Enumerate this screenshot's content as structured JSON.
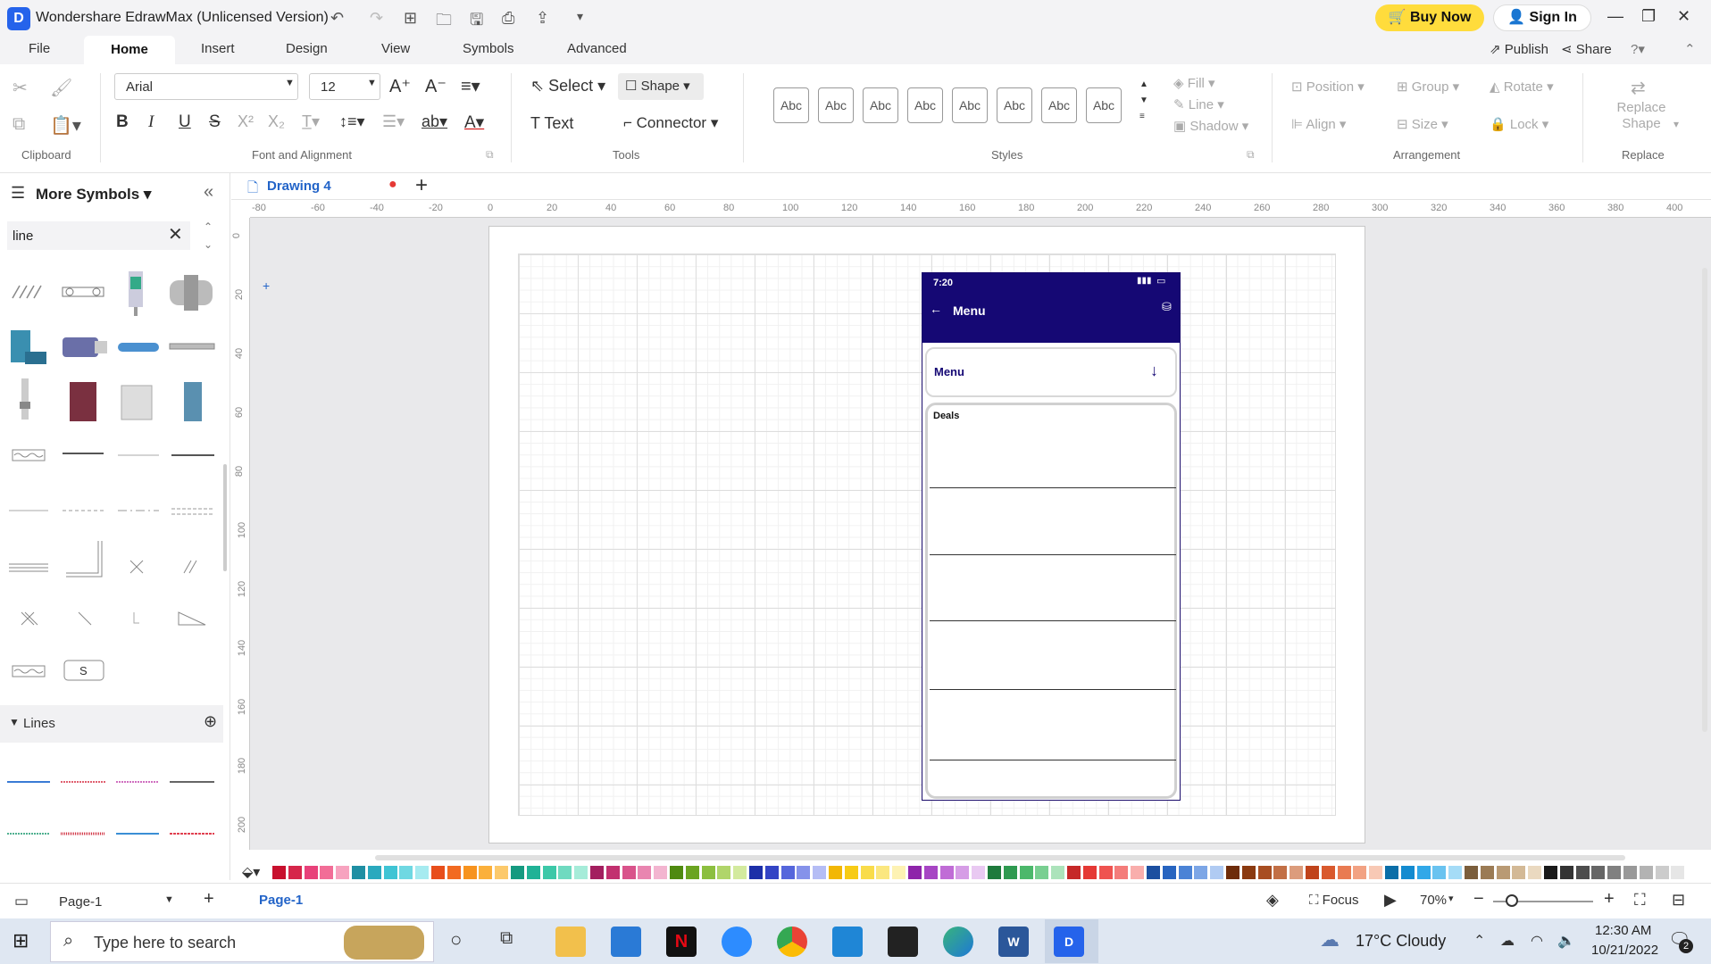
{
  "app": {
    "title": "Wondershare EdrawMax (Unlicensed Version)",
    "buy_now": "Buy Now",
    "sign_in": "Sign In",
    "publish": "Publish",
    "share": "Share"
  },
  "menu": {
    "tabs": [
      "File",
      "Home",
      "Insert",
      "Design",
      "View",
      "Symbols",
      "Advanced"
    ]
  },
  "ribbon": {
    "font": "Arial",
    "size": "12",
    "select": "Select",
    "shape": "Shape",
    "text": "Text",
    "connector": "Connector",
    "style_swatch": "Abc",
    "fill": "Fill",
    "line": "Line",
    "shadow": "Shadow",
    "position": "Position",
    "group": "Group",
    "rotate": "Rotate",
    "align": "Align",
    "size_btn": "Size",
    "lock": "Lock",
    "replace_shape": "Replace Shape",
    "groups": {
      "clipboard": "Clipboard",
      "font": "Font and Alignment",
      "tools": "Tools",
      "styles": "Styles",
      "arrangement": "Arrangement",
      "replace": "Replace"
    }
  },
  "panel": {
    "title": "More Symbols",
    "search_value": "line",
    "lines_section": "Lines"
  },
  "doc": {
    "tab": "Drawing 4"
  },
  "ruler": {
    "h": [
      "-80",
      "-60",
      "-40",
      "-20",
      "0",
      "20",
      "40",
      "60",
      "80",
      "100",
      "120",
      "140",
      "160",
      "180",
      "200",
      "220",
      "240",
      "260",
      "280",
      "300",
      "320",
      "340",
      "360",
      "380",
      "400"
    ],
    "v": [
      "0",
      "20",
      "40",
      "60",
      "80",
      "100",
      "120",
      "140",
      "160",
      "180",
      "200"
    ]
  },
  "phone": {
    "time": "7:20",
    "title": "Menu",
    "menu_label": "Menu",
    "deals_label": "Deals"
  },
  "palette": [
    "#c8102e",
    "#d6264a",
    "#e8417a",
    "#f26d97",
    "#f7a3bf",
    "#1f8fa3",
    "#2aa9be",
    "#3fc4d4",
    "#6fd8e2",
    "#a6ebf0",
    "#e84e1b",
    "#f26a21",
    "#f7931e",
    "#fbb03b",
    "#fcc96b",
    "#159a80",
    "#20b296",
    "#3cc8a8",
    "#6fdac0",
    "#a6ecd9",
    "#a31f5f",
    "#c2306f",
    "#d9538b",
    "#e985b0",
    "#f3b5d0",
    "#4f8a10",
    "#6ba421",
    "#8cbf3f",
    "#b0d56a",
    "#d3ea9e",
    "#1c2fa8",
    "#3344c5",
    "#5566dc",
    "#8592ea",
    "#b5bdf5",
    "#f2b705",
    "#f7cb15",
    "#f9dc4a",
    "#fbe77f",
    "#fdf2b3",
    "#8e24aa",
    "#a745c4",
    "#c06cd6",
    "#d69de6",
    "#e9c9f2",
    "#1e7a3c",
    "#2e9a50",
    "#4cb86b",
    "#79cf91",
    "#ace3bb",
    "#c62828",
    "#e53935",
    "#ef5350",
    "#f47c7a",
    "#f9aeac",
    "#1b4fa0",
    "#2764c0",
    "#4b83d6",
    "#7ca6e6",
    "#b0cbf3",
    "#6d2c0a",
    "#8b3a10",
    "#a84e22",
    "#c26f45",
    "#dc9c7c",
    "#c0441c",
    "#d9592d",
    "#e97b52",
    "#f2a283",
    "#f8c9b5",
    "#0b6ea8",
    "#138bd0",
    "#31a8e8",
    "#69c3f0",
    "#a5dcf7",
    "#7b5e3c",
    "#9b7b55",
    "#b99a74",
    "#d3b996",
    "#ead9c0",
    "#1a1a1a",
    "#333333",
    "#4d4d4d",
    "#666666",
    "#808080",
    "#999999",
    "#b3b3b3",
    "#cccccc",
    "#e6e6e6"
  ],
  "status": {
    "page_select": "Page-1",
    "page_tab": "Page-1",
    "focus": "Focus",
    "zoom": "70%"
  },
  "taskbar": {
    "search_placeholder": "Type here to search",
    "weather": "17°C Cloudy",
    "time": "12:30 AM",
    "date": "10/21/2022",
    "notif": "2"
  }
}
